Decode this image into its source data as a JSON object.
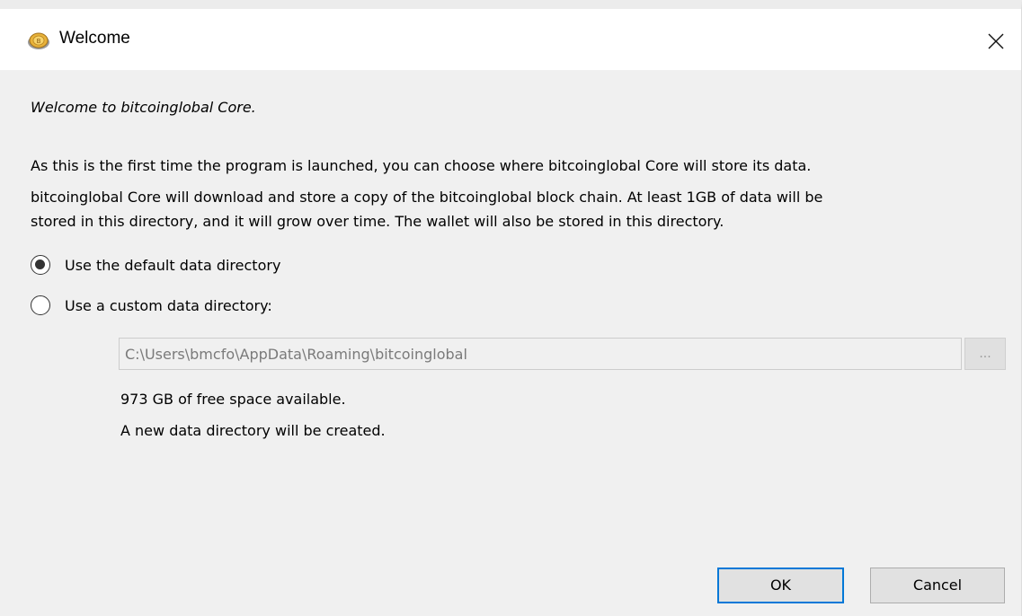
{
  "window": {
    "title": "Welcome",
    "app_icon": "bitcoinglobal-coin-icon",
    "close_icon": "close-icon"
  },
  "content": {
    "welcome_line": "Welcome to bitcoinglobal Core.",
    "intro_line": "As this is the first time the program is launched, you can choose where bitcoinglobal Core will store its data.",
    "description_line1": "bitcoinglobal Core will download and store a copy of the bitcoinglobal block chain. At least 1GB of data will be",
    "description_line2": "stored in this directory, and it will grow over time. The wallet will also be stored in this directory."
  },
  "options": {
    "default_label": "Use the default data directory",
    "default_checked": true,
    "custom_label": "Use a custom data directory:",
    "custom_checked": false
  },
  "directory": {
    "path_value": "C:\\Users\\bmcfo\\AppData\\Roaming\\bitcoinglobal",
    "browse_label": "...",
    "free_space": "973 GB of free space available.",
    "status": "A new data directory will be created."
  },
  "buttons": {
    "ok_label": "OK",
    "cancel_label": "Cancel"
  },
  "colors": {
    "dialog_bg": "#f0f0f0",
    "titlebar_bg": "#ffffff",
    "focus_accent": "#0078d7",
    "button_bg": "#e1e1e1"
  }
}
